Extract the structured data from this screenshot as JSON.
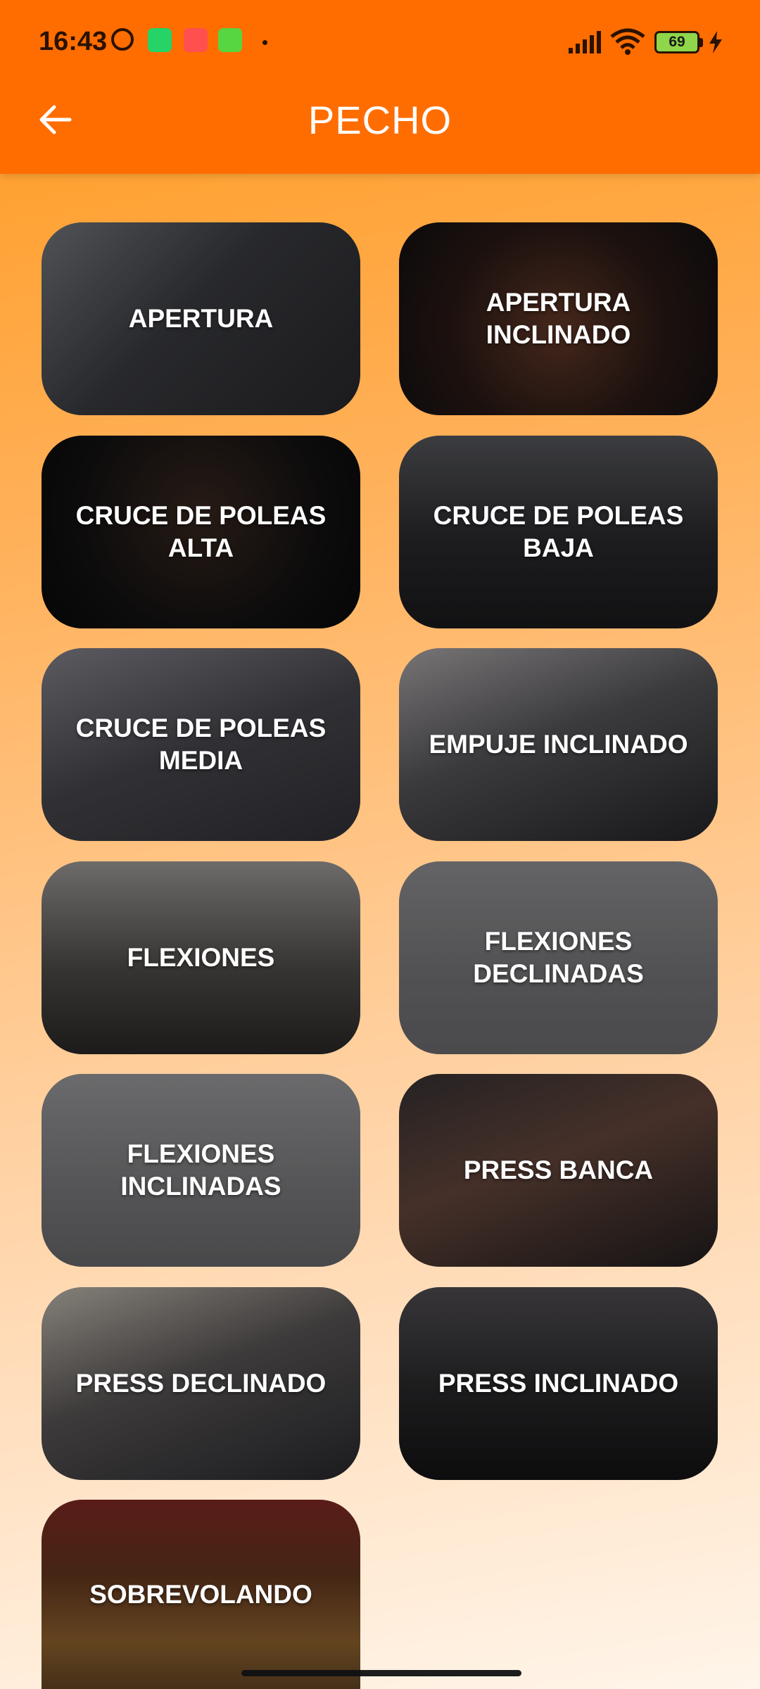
{
  "status_bar": {
    "time": "16:43",
    "battery_level": "69",
    "icons": [
      "alarm-icon",
      "whatsapp-icon",
      "screen-record-icon",
      "download-icon",
      "signal-icon",
      "wifi-icon",
      "battery-icon",
      "charging-icon"
    ]
  },
  "app_bar": {
    "title": "PECHO",
    "back_icon": "arrow-left-icon",
    "color": "#ff6d00"
  },
  "exercises": [
    {
      "label": "APERTURA"
    },
    {
      "label": "APERTURA\nINCLINADO"
    },
    {
      "label": "CRUCE DE POLEAS\nALTA"
    },
    {
      "label": "CRUCE DE POLEAS\nBAJA"
    },
    {
      "label": "CRUCE DE POLEAS\nMEDIA"
    },
    {
      "label": "EMPUJE INCLINADO"
    },
    {
      "label": "FLEXIONES"
    },
    {
      "label": "FLEXIONES\nDECLINADAS"
    },
    {
      "label": "FLEXIONES\nINCLINADAS"
    },
    {
      "label": "PRESS BANCA"
    },
    {
      "label": "PRESS DECLINADO"
    },
    {
      "label": "PRESS INCLINADO"
    },
    {
      "label": "SOBREVOLANDO"
    }
  ]
}
